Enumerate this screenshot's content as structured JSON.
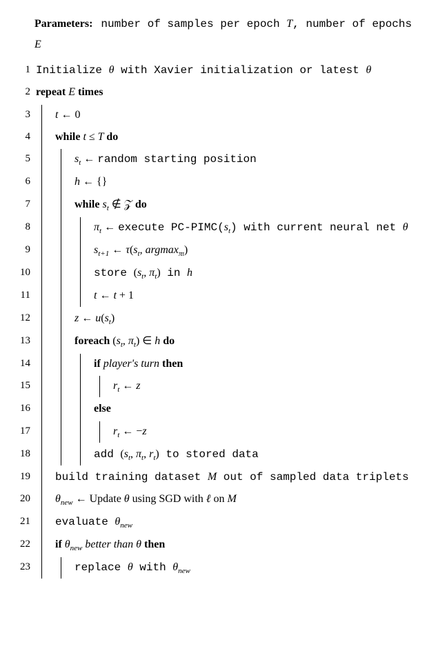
{
  "params": {
    "label": "Parameters:",
    "text1": "number of samples per epoch ",
    "var1": "T",
    "text2": ", number of epochs ",
    "var2": "E"
  },
  "lines": {
    "l1a": "Initialize ",
    "l1b": "θ",
    "l1c": " with Xavier initialization or latest ",
    "l1d": "θ",
    "l2a": "repeat",
    "l2b": " E ",
    "l2c": "times",
    "l3a": "t",
    "l3b": " ← 0",
    "l4a": "while",
    "l4b": " t ≤ T ",
    "l4c": "do",
    "l5a": "s",
    "l5b": " ← ",
    "l5c": "random starting position",
    "l6a": "h",
    "l6b": " ← {}",
    "l7a": "while",
    "l7b": " s",
    "l7c": " ∉ 𝒵 ",
    "l7d": "do",
    "l8a": "π",
    "l8b": " ← ",
    "l8c": "execute ",
    "l8d": "PC-PIMC(",
    "l8e": "s",
    "l8f": ")",
    "l8g": " with current neural net ",
    "l8h": "θ",
    "l9a": "s",
    "l9b": " ← ",
    "l9c": "τ",
    "l9d": "(",
    "l9e": "s",
    "l9f": ", ",
    "l9g": "argmax",
    "l9h": ")",
    "l10a": "store ",
    "l10b": "(",
    "l10c": "s",
    "l10d": ", ",
    "l10e": "π",
    "l10f": ")",
    "l10g": " in ",
    "l10h": "h",
    "l11a": "t",
    "l11b": " ← ",
    "l11c": "t",
    "l11d": " + 1",
    "l12a": "z",
    "l12b": " ← ",
    "l12c": "u",
    "l12d": "(",
    "l12e": "s",
    "l12f": ")",
    "l13a": "foreach",
    "l13b": " (",
    "l13c": "s",
    "l13d": ", ",
    "l13e": "π",
    "l13f": ") ∈ ",
    "l13g": "h",
    "l13h": " ",
    "l13i": "do",
    "l14a": "if",
    "l14b": " player's turn ",
    "l14c": "then",
    "l15a": "r",
    "l15b": " ← ",
    "l15c": "z",
    "l16a": "else",
    "l17a": "r",
    "l17b": " ← −",
    "l17c": "z",
    "l18a": "add ",
    "l18b": "(",
    "l18c": "s",
    "l18d": ", ",
    "l18e": "π",
    "l18f": ", ",
    "l18g": "r",
    "l18h": ")",
    "l18i": " to stored data",
    "l19a": "build training dataset ",
    "l19b": "M",
    "l19c": " out of sampled data triplets",
    "l20a": "θ",
    "l20b": " ← ",
    "l20c": "Update ",
    "l20d": "θ",
    "l20e": " using SGD with ",
    "l20f": "ℓ",
    "l20g": " on ",
    "l20h": "M",
    "l21a": "evaluate ",
    "l21b": "θ",
    "l22a": "if",
    "l22b": " θ",
    "l22c": " better than ",
    "l22d": "θ",
    "l22e": " ",
    "l22f": "then",
    "l23a": "replace ",
    "l23b": "θ",
    "l23c": " with ",
    "l23d": "θ",
    "subt": "t",
    "subt1": "t+1",
    "subpi": "π",
    "subnew": "new"
  },
  "linenos": {
    "n1": "1",
    "n2": "2",
    "n3": "3",
    "n4": "4",
    "n5": "5",
    "n6": "6",
    "n7": "7",
    "n8": "8",
    "n9": "9",
    "n10": "10",
    "n11": "11",
    "n12": "12",
    "n13": "13",
    "n14": "14",
    "n15": "15",
    "n16": "16",
    "n17": "17",
    "n18": "18",
    "n19": "19",
    "n20": "20",
    "n21": "21",
    "n22": "22",
    "n23": "23"
  }
}
